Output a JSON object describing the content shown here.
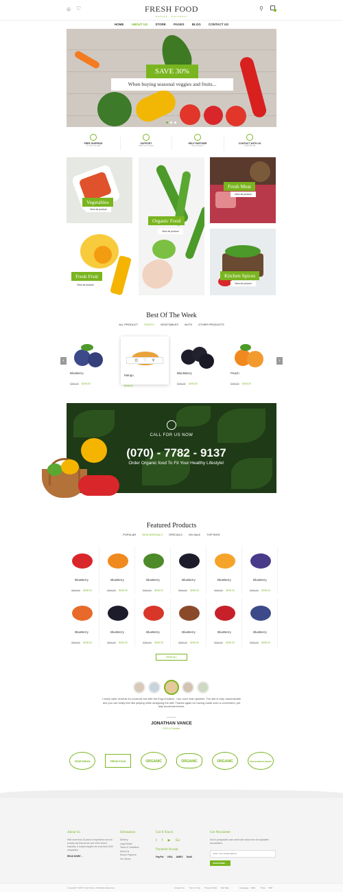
{
  "header": {
    "logo": "FRESH FOOD",
    "logo_sub": "NATURE · NATURELY",
    "nav": [
      "HOME",
      "ABOUT US",
      "STORE",
      "PAGES",
      "BLOG",
      "CONTACT US"
    ],
    "nav_active": "ABOUT US"
  },
  "hero": {
    "badge": "SAVE 30%",
    "tagline": "When buying seasonal veggies and fruits..."
  },
  "features": [
    {
      "title": "FREE SHIPPING",
      "sub": "On order over $99"
    },
    {
      "title": "SUPPORT",
      "sub": "Online 24/7 support"
    },
    {
      "title": "HELP PARTNER",
      "sub": "Help all aspects"
    },
    {
      "title": "CONTACT WITH US",
      "sub": "+0123 456 789"
    }
  ],
  "categories": [
    {
      "name": "Vegetables",
      "link": "View all product"
    },
    {
      "name": "Organic Food",
      "link": "View all product"
    },
    {
      "name": "Fresh Meat",
      "link": "View all product"
    },
    {
      "name": "Fresh Fruit",
      "link": "View all product"
    },
    {
      "name": "Kitchen Spices",
      "link": "View all product"
    }
  ],
  "best": {
    "title": "Best Of The Week",
    "tabs": [
      "ALL PRODUCT",
      "FRUITS",
      "VEGETABLES",
      "NUTS",
      "OTHER PRODUCTS"
    ],
    "active_tab": "FRUITS",
    "products": [
      {
        "name": "BlueBerry",
        "old": "$360.00",
        "new": "$208.00",
        "color": "#3c4a8a"
      },
      {
        "name": "Mango",
        "old": "",
        "new": "$208.00",
        "color": "#e8a23a"
      },
      {
        "name": "BlackBerry",
        "old": "$360.00",
        "new": "$208.00",
        "color": "#1c1c2a"
      },
      {
        "name": "Peach",
        "old": "$360.00",
        "new": "$208.00",
        "color": "#f08a1e"
      }
    ]
  },
  "banner": {
    "call_label": "CALL FOR US NOW",
    "phone": "(070) - 7782 - 9137",
    "sub": "Order Organic food To Fit Your Healthy Lifestyle!"
  },
  "featured": {
    "title": "Featured Products",
    "tabs": [
      "POPULAR",
      "NEW ARRIVALS",
      "SPECIALS",
      "ON SALE",
      "TOP RATE"
    ],
    "active_tab": "NEW ARRIVALS",
    "products": [
      {
        "name": "BlueBerry",
        "old": "$360.00",
        "new": "$208.00",
        "color": "#d9262a"
      },
      {
        "name": "BlueBerry",
        "old": "$360.00",
        "new": "$208.00",
        "color": "#f08a1e"
      },
      {
        "name": "BlueBerry",
        "old": "$360.00",
        "new": "$208.00",
        "color": "#4c8a2a"
      },
      {
        "name": "BlueBerry",
        "old": "$360.00",
        "new": "$208.00",
        "color": "#1c1c2a"
      },
      {
        "name": "BlueBerry",
        "old": "$360.00",
        "new": "$208.00",
        "color": "#f5a32a"
      },
      {
        "name": "BlueBerry",
        "old": "$360.00",
        "new": "$208.00",
        "color": "#4a3a8a"
      },
      {
        "name": "BlueBerry",
        "old": "$360.00",
        "new": "$208.00",
        "color": "#e86a2a"
      },
      {
        "name": "BlueBerry",
        "old": "$360.00",
        "new": "$208.00",
        "color": "#1c1c2a"
      },
      {
        "name": "BlueBerry",
        "old": "$360.00",
        "new": "$208.00",
        "color": "#d9362a"
      },
      {
        "name": "BlueBerry",
        "old": "$360.00",
        "new": "$208.00",
        "color": "#8a4a2a"
      },
      {
        "name": "BlueBerry",
        "old": "$360.00",
        "new": "$208.00",
        "color": "#c8202a"
      },
      {
        "name": "BlueBerry",
        "old": "$360.00",
        "new": "$208.00",
        "color": "#3c4a8a"
      }
    ],
    "view_all": "VIEW ALL"
  },
  "testimonial": {
    "text": "I rarely write reviews for products but with the EngoCreative, I am more than grateful. The site is fully customizable and you can really feel like playing while designing the site! Thanks again for having made such a convenient, yet fully functional theme.",
    "name": "JONATHAN VANCE",
    "role": "CEO & Founder"
  },
  "badges": [
    "VEGETARIAN",
    "FRESH FOOD",
    "ORGANIC",
    "ORGANIC",
    "ORGANIC",
    "VEGAN RESTAURANT"
  ],
  "footer": {
    "about": {
      "title": "About Us",
      "text": "With more than 15 years of experience we can proudly say that we are one of the best in business, a trusted supplier for more than 1000 companies...",
      "link": "READ MORE →"
    },
    "info": {
      "title": "Infomation",
      "links": [
        "Delivery",
        "Legal Notice",
        "Terms & Conditions",
        "About Us",
        "Secure Payment",
        "Our Stores"
      ]
    },
    "touch": {
      "title": "Get It Touch",
      "payment_title": "Payment Accept",
      "payments": [
        "PayPal",
        "VISA",
        "AMEX",
        "Skrill"
      ]
    },
    "newsletter": {
      "title": "Get Newsletter",
      "text": "Sed ut perspiciatis unde omnis iste natus error sit voluptatem accusantium.",
      "placeholder": "Enter Your Email Address",
      "button": "SUBSCRIBE →"
    },
    "copyright": "Copyright © 2017 Fresh Food - All Rights Reserved.",
    "bottom_links": [
      "Contact Us",
      "Term of Use",
      "Privacy Policy",
      "Site Map"
    ],
    "language_label": "Language:",
    "language": "ENG",
    "price_label": "Price:",
    "price": "USD"
  }
}
